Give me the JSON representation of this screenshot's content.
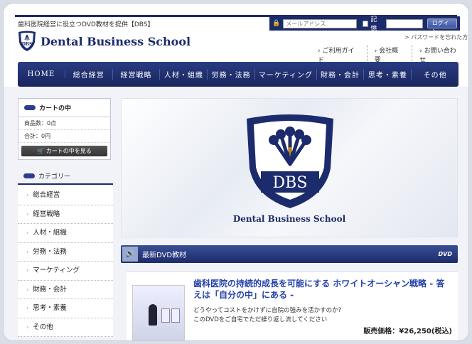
{
  "header": {
    "tagline": "歯科医院経営に役立つDVD教材を提供【DBS】",
    "logo_text": "Dental Business School"
  },
  "login": {
    "email_placeholder": "メールアドレス",
    "remember_label": "記憶",
    "login_button": "ログイン",
    "forgot_link": "> パスワードを忘れた方"
  },
  "top_links": [
    "ご利用ガイド",
    "会社概要",
    "お問い合わせ"
  ],
  "nav": [
    "HOME",
    "総合経営",
    "経営戦略",
    "人材・組織",
    "労務・法務",
    "マーケティング",
    "財務・会計",
    "思考・素養",
    "その他"
  ],
  "cart": {
    "title": "カートの中",
    "count": "商品数：0点",
    "total": "合計：0円",
    "button": "カートの中を見る"
  },
  "category": {
    "title": "カテゴリー",
    "items": [
      "総合経営",
      "経営戦略",
      "人材・組織",
      "労務・法務",
      "マーケティング",
      "財務・会計",
      "思考・素養",
      "その他"
    ]
  },
  "hero": {
    "emblem_text": "DBS",
    "caption": "Dental Business School"
  },
  "section": {
    "title": "最新DVD教材",
    "badge": "DVD"
  },
  "product": {
    "title": "歯科医院の持続的成長を可能にする ホワイトオーシャン戦略 - 答えは「自分の中」にある -",
    "desc_line1": "どうやってコストをかけずに自院の強みを活かすのか?",
    "desc_line2": "このDVDをご自宅でただ繰り返し流してください",
    "price": "販売価格：¥26,250(税込)"
  },
  "colors": {
    "navy": "#1c2b6b",
    "link_blue": "#2440a8"
  }
}
